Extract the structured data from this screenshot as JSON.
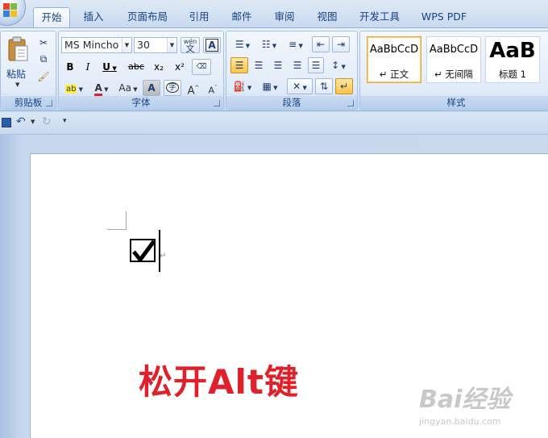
{
  "tabs": [
    {
      "label": "开始",
      "active": true
    },
    {
      "label": "插入"
    },
    {
      "label": "页面布局"
    },
    {
      "label": "引用"
    },
    {
      "label": "邮件"
    },
    {
      "label": "审阅"
    },
    {
      "label": "视图"
    },
    {
      "label": "开发工具"
    },
    {
      "label": "WPS PDF"
    }
  ],
  "clipboard": {
    "paste_label": "粘贴",
    "group_label": "剪贴板"
  },
  "font": {
    "family": "MS Mincho",
    "size": "30",
    "group_label": "字体",
    "bold": "B",
    "italic": "I",
    "underline": "U",
    "strike": "abc",
    "subscript": "x₂",
    "superscript": "x²",
    "change_case": "Aa",
    "char_border": "A",
    "phonetic": "wén",
    "enclose": "字",
    "grow": "A",
    "shrink": "A",
    "font_color": "A",
    "highlight": "ab"
  },
  "paragraph": {
    "group_label": "段落"
  },
  "styles": {
    "group_label": "样式",
    "items": [
      {
        "sample": "AaBbCcD",
        "name": "↵ 正文",
        "selected": true
      },
      {
        "sample": "AaBbCcD",
        "name": "↵ 无间隔"
      },
      {
        "sample": "AaB",
        "name": "标题 1"
      }
    ]
  },
  "document": {
    "overlay_text": "松开Alt键"
  },
  "watermark": {
    "logo": "Bai经验",
    "url": "jingyan.baidu.com"
  },
  "colors": {
    "accent": "#e0202a",
    "ribbon": "#dbe7f6",
    "selected": "#ffc347"
  }
}
